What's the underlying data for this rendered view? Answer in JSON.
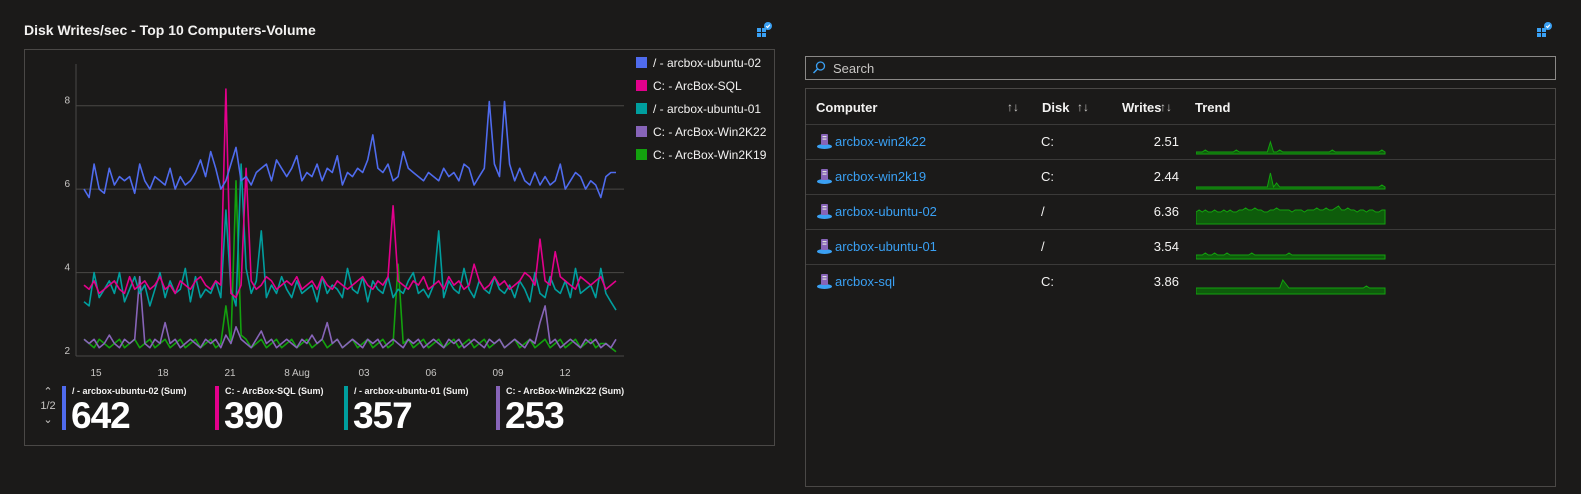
{
  "left_panel": {
    "title": "Disk Writes/sec - Top 10 Computers-Volume",
    "pin_icon": "pin-to-dashboard-icon"
  },
  "right_panel": {
    "pin_icon": "pin-to-dashboard-icon"
  },
  "chart_data": {
    "type": "line",
    "x_tick_labels": [
      "15",
      "18",
      "21",
      "8 Aug",
      "03",
      "06",
      "09",
      "12"
    ],
    "y_tick_labels": [
      "2",
      "4",
      "6",
      "8"
    ],
    "ylim": [
      2,
      9
    ],
    "grid": true,
    "legend_position": "right",
    "series": [
      {
        "name": "/ - arcbox-ubuntu-02",
        "color": "#4f6bed",
        "values": [
          6.0,
          5.8,
          6.6,
          6.0,
          5.9,
          6.5,
          6.1,
          6.3,
          6.2,
          6.3,
          5.9,
          6.6,
          6.2,
          6.0,
          6.3,
          6.2,
          6.1,
          6.5,
          6.0,
          6.3,
          6.1,
          6.2,
          6.4,
          6.7,
          6.3,
          6.9,
          6.5,
          6.0,
          6.2,
          6.6,
          7.0,
          6.2,
          6.3,
          6.1,
          6.4,
          6.5,
          6.6,
          6.2,
          6.7,
          6.5,
          6.3,
          6.5,
          6.8,
          6.2,
          6.4,
          6.3,
          6.6,
          6.2,
          6.5,
          6.4,
          6.8,
          6.1,
          6.4,
          6.3,
          6.5,
          6.4,
          6.7,
          7.3,
          6.5,
          6.4,
          6.6,
          6.2,
          6.3,
          6.9,
          6.5,
          6.4,
          6.3,
          6.2,
          6.4,
          6.3,
          6.2,
          6.5,
          6.3,
          6.4,
          6.2,
          6.6,
          6.5,
          6.1,
          6.3,
          6.5,
          8.1,
          6.6,
          6.3,
          8.1,
          6.6,
          6.2,
          6.5,
          6.2,
          6.1,
          6.4,
          6.1,
          6.3,
          6.1,
          6.2,
          6.6,
          6.0,
          6.2,
          6.4,
          6.3,
          6.0,
          6.2,
          6.1,
          5.8,
          6.3,
          6.4,
          6.4
        ]
      },
      {
        "name": "C: - ArcBox-SQL",
        "color": "#e3008c",
        "values": [
          3.7,
          3.6,
          3.8,
          3.5,
          3.6,
          3.7,
          3.8,
          3.6,
          3.5,
          3.9,
          3.6,
          3.7,
          3.8,
          3.6,
          3.7,
          3.9,
          3.6,
          3.7,
          3.5,
          3.8,
          3.7,
          3.6,
          3.8,
          3.9,
          3.7,
          3.6,
          3.8,
          3.7,
          8.4,
          3.5,
          3.4,
          3.7,
          6.5,
          3.8,
          3.6,
          3.7,
          3.9,
          3.8,
          3.6,
          3.7,
          3.8,
          3.7,
          3.9,
          3.6,
          3.7,
          3.8,
          3.6,
          3.9,
          3.7,
          3.6,
          3.8,
          3.7,
          3.6,
          3.7,
          3.8,
          3.9,
          3.7,
          3.6,
          3.8,
          3.7,
          3.9,
          5.6,
          3.8,
          3.7,
          3.6,
          3.8,
          3.7,
          3.9,
          3.6,
          3.7,
          3.8,
          3.6,
          3.9,
          3.7,
          3.8,
          3.6,
          3.7,
          4.2,
          3.8,
          3.6,
          3.7,
          3.9,
          3.7,
          3.8,
          3.6,
          3.7,
          3.8,
          4.0,
          3.9,
          3.7,
          4.8,
          3.8,
          3.7,
          4.5,
          3.9,
          3.8,
          3.7,
          3.6,
          3.9,
          3.8,
          3.7,
          3.8,
          3.9,
          3.6,
          3.7,
          3.8
        ]
      },
      {
        "name": "/ - arcbox-ubuntu-01",
        "color": "#009e9e",
        "values": [
          3.3,
          3.2,
          4.0,
          3.4,
          3.6,
          3.8,
          3.5,
          4.0,
          3.3,
          3.6,
          3.9,
          3.5,
          3.7,
          3.2,
          3.6,
          4.0,
          3.4,
          3.8,
          3.5,
          3.6,
          4.1,
          3.3,
          3.9,
          3.4,
          3.6,
          3.5,
          3.8,
          3.4,
          5.5,
          3.6,
          3.2,
          6.6,
          4.1,
          3.5,
          3.8,
          5.0,
          3.4,
          3.7,
          3.5,
          3.9,
          3.6,
          3.4,
          3.8,
          3.5,
          3.6,
          3.7,
          3.3,
          3.9,
          3.5,
          3.7,
          3.6,
          3.4,
          4.1,
          3.6,
          3.5,
          3.9,
          3.3,
          3.8,
          3.6,
          3.5,
          3.9,
          3.4,
          3.6,
          3.5,
          3.8,
          4.0,
          3.5,
          3.6,
          3.4,
          3.7,
          5.0,
          3.4,
          3.8,
          3.6,
          3.5,
          4.1,
          3.6,
          3.4,
          3.8,
          3.6,
          3.5,
          3.9,
          3.6,
          3.5,
          3.7,
          3.4,
          3.8,
          3.6,
          3.3,
          4.0,
          3.5,
          3.4,
          3.9,
          3.6,
          3.5,
          3.8,
          3.4,
          4.1,
          3.5,
          3.6,
          3.7,
          3.4,
          4.1,
          3.5,
          3.3,
          3.1
        ]
      },
      {
        "name": "C: - ArcBox-Win2K22",
        "color": "#8764b8",
        "values": [
          2.4,
          2.3,
          2.4,
          2.2,
          2.3,
          2.5,
          2.3,
          2.2,
          2.4,
          2.3,
          2.4,
          3.9,
          2.3,
          2.2,
          2.4,
          2.3,
          2.8,
          2.3,
          2.4,
          2.2,
          2.3,
          2.4,
          2.3,
          2.2,
          2.4,
          2.3,
          2.4,
          2.2,
          2.5,
          2.3,
          2.7,
          2.4,
          2.3,
          2.2,
          2.4,
          2.6,
          2.3,
          2.4,
          2.2,
          2.3,
          2.4,
          2.3,
          2.2,
          2.4,
          2.3,
          2.5,
          2.3,
          2.4,
          2.8,
          2.3,
          2.4,
          2.2,
          2.3,
          2.4,
          2.3,
          2.2,
          2.4,
          2.3,
          2.4,
          2.2,
          2.3,
          2.4,
          2.3,
          2.2,
          2.4,
          2.3,
          2.4,
          2.2,
          2.3,
          2.4,
          2.3,
          2.2,
          2.4,
          2.3,
          2.4,
          2.2,
          2.3,
          2.4,
          2.3,
          2.2,
          2.4,
          2.3,
          2.4,
          2.2,
          2.3,
          2.4,
          2.3,
          2.2,
          2.4,
          2.3,
          2.8,
          3.2,
          2.3,
          2.4,
          2.2,
          2.3,
          2.4,
          2.3,
          2.2,
          2.4,
          2.3,
          2.4,
          2.2,
          2.3,
          2.2,
          2.4
        ]
      },
      {
        "name": "C: - ArcBox-Win2K19",
        "color": "#13a10e",
        "values": [
          2.4,
          2.3,
          2.2,
          2.4,
          2.3,
          2.2,
          2.3,
          2.4,
          2.2,
          2.3,
          2.4,
          2.2,
          2.3,
          2.4,
          2.2,
          2.3,
          2.4,
          2.2,
          2.3,
          2.4,
          2.2,
          2.3,
          2.4,
          2.2,
          2.3,
          2.4,
          2.2,
          2.3,
          3.2,
          2.3,
          6.2,
          2.5,
          2.4,
          2.2,
          2.3,
          2.4,
          2.2,
          2.3,
          2.4,
          2.2,
          2.3,
          2.4,
          2.2,
          2.3,
          2.4,
          2.2,
          2.3,
          2.4,
          2.2,
          2.3,
          2.4,
          2.2,
          2.3,
          2.4,
          2.2,
          2.3,
          2.4,
          2.2,
          2.3,
          2.4,
          2.2,
          2.3,
          4.2,
          2.3,
          2.4,
          2.2,
          2.3,
          2.4,
          2.2,
          2.3,
          2.4,
          2.2,
          2.3,
          2.4,
          2.2,
          2.3,
          2.4,
          2.2,
          2.3,
          2.4,
          2.2,
          2.3,
          2.4,
          2.2,
          2.3,
          2.4,
          2.2,
          2.3,
          2.4,
          2.2,
          2.3,
          2.4,
          2.2,
          2.3,
          2.4,
          2.2,
          2.3,
          2.4,
          2.2,
          2.3,
          2.4,
          2.2,
          2.3,
          2.3,
          2.2,
          2.1
        ]
      }
    ]
  },
  "summary": {
    "pager_label": "1/2",
    "pager_up_icon": "chevron-up-icon",
    "pager_down_icon": "chevron-down-icon",
    "tiles": [
      {
        "label": "/ - arcbox-ubuntu-02 (Sum)",
        "value": "642",
        "color": "#4f6bed"
      },
      {
        "label": "C: - ArcBox-SQL (Sum)",
        "value": "390",
        "color": "#e3008c"
      },
      {
        "label": "/ - arcbox-ubuntu-01 (Sum)",
        "value": "357",
        "color": "#009e9e"
      },
      {
        "label": "C: - ArcBox-Win2K22 (Sum)",
        "value": "253",
        "color": "#8764b8"
      }
    ]
  },
  "grid": {
    "search_placeholder": "Search",
    "search_icon": "search-icon",
    "columns": {
      "computer": "Computer",
      "disk": "Disk",
      "writes": "Writes",
      "trend": "Trend"
    },
    "sort_glyph": "↑↓",
    "rows": [
      {
        "computer": "arcbox-win2k22",
        "disk": "C:",
        "writes": "2.51",
        "trend": [
          1,
          1,
          1,
          2,
          1,
          1,
          1,
          1,
          1,
          1,
          1,
          1,
          1,
          2,
          1,
          1,
          1,
          1,
          1,
          1,
          1,
          1,
          1,
          1,
          6,
          1,
          1,
          2,
          1,
          1,
          1,
          1,
          1,
          1,
          1,
          1,
          1,
          1,
          1,
          1,
          1,
          1,
          1,
          1,
          2,
          1,
          1,
          1,
          1,
          1,
          1,
          1,
          1,
          1,
          1,
          1,
          1,
          1,
          1,
          1,
          2,
          1
        ]
      },
      {
        "computer": "arcbox-win2k19",
        "disk": "C:",
        "writes": "2.44",
        "trend": [
          1,
          1,
          1,
          1,
          1,
          1,
          1,
          1,
          1,
          1,
          1,
          1,
          1,
          1,
          1,
          1,
          1,
          1,
          1,
          1,
          1,
          1,
          1,
          1,
          8,
          1,
          3,
          1,
          1,
          1,
          1,
          1,
          1,
          1,
          1,
          1,
          1,
          1,
          1,
          1,
          1,
          1,
          1,
          1,
          1,
          1,
          1,
          1,
          1,
          1,
          1,
          1,
          1,
          1,
          1,
          1,
          1,
          1,
          1,
          1,
          2,
          1
        ]
      },
      {
        "computer": "arcbox-ubuntu-02",
        "disk": "/",
        "writes": "6.36",
        "trend": [
          6,
          7,
          6,
          7,
          6,
          6,
          7,
          6,
          6,
          7,
          6,
          7,
          6,
          6,
          7,
          7,
          8,
          7,
          7,
          8,
          7,
          7,
          6,
          6,
          7,
          7,
          8,
          7,
          7,
          7,
          7,
          6,
          7,
          7,
          7,
          6,
          7,
          7,
          7,
          8,
          7,
          7,
          8,
          7,
          7,
          8,
          9,
          7,
          7,
          8,
          7,
          7,
          6,
          7,
          7,
          6,
          7,
          7,
          6,
          6,
          7,
          7
        ]
      },
      {
        "computer": "arcbox-ubuntu-01",
        "disk": "/",
        "writes": "3.54",
        "trend": [
          2,
          2,
          2,
          3,
          2,
          2,
          3,
          2,
          2,
          2,
          3,
          2,
          2,
          2,
          2,
          2,
          2,
          2,
          3,
          2,
          2,
          2,
          2,
          2,
          2,
          2,
          2,
          2,
          2,
          2,
          3,
          2,
          2,
          2,
          2,
          2,
          2,
          2,
          2,
          2,
          2,
          2,
          2,
          2,
          2,
          2,
          2,
          2,
          2,
          2,
          2,
          2,
          2,
          2,
          2,
          2,
          2,
          2,
          2,
          2,
          2,
          2
        ]
      },
      {
        "computer": "arcbox-sql",
        "disk": "C:",
        "writes": "3.86",
        "trend": [
          3,
          3,
          3,
          3,
          3,
          3,
          3,
          3,
          3,
          3,
          3,
          3,
          3,
          3,
          3,
          3,
          3,
          3,
          3,
          3,
          3,
          3,
          3,
          3,
          3,
          3,
          3,
          3,
          7,
          5,
          3,
          3,
          3,
          3,
          3,
          3,
          3,
          3,
          3,
          3,
          3,
          3,
          3,
          3,
          3,
          3,
          3,
          3,
          3,
          3,
          3,
          3,
          3,
          3,
          3,
          4,
          3,
          3,
          3,
          3,
          3,
          3
        ]
      }
    ]
  }
}
